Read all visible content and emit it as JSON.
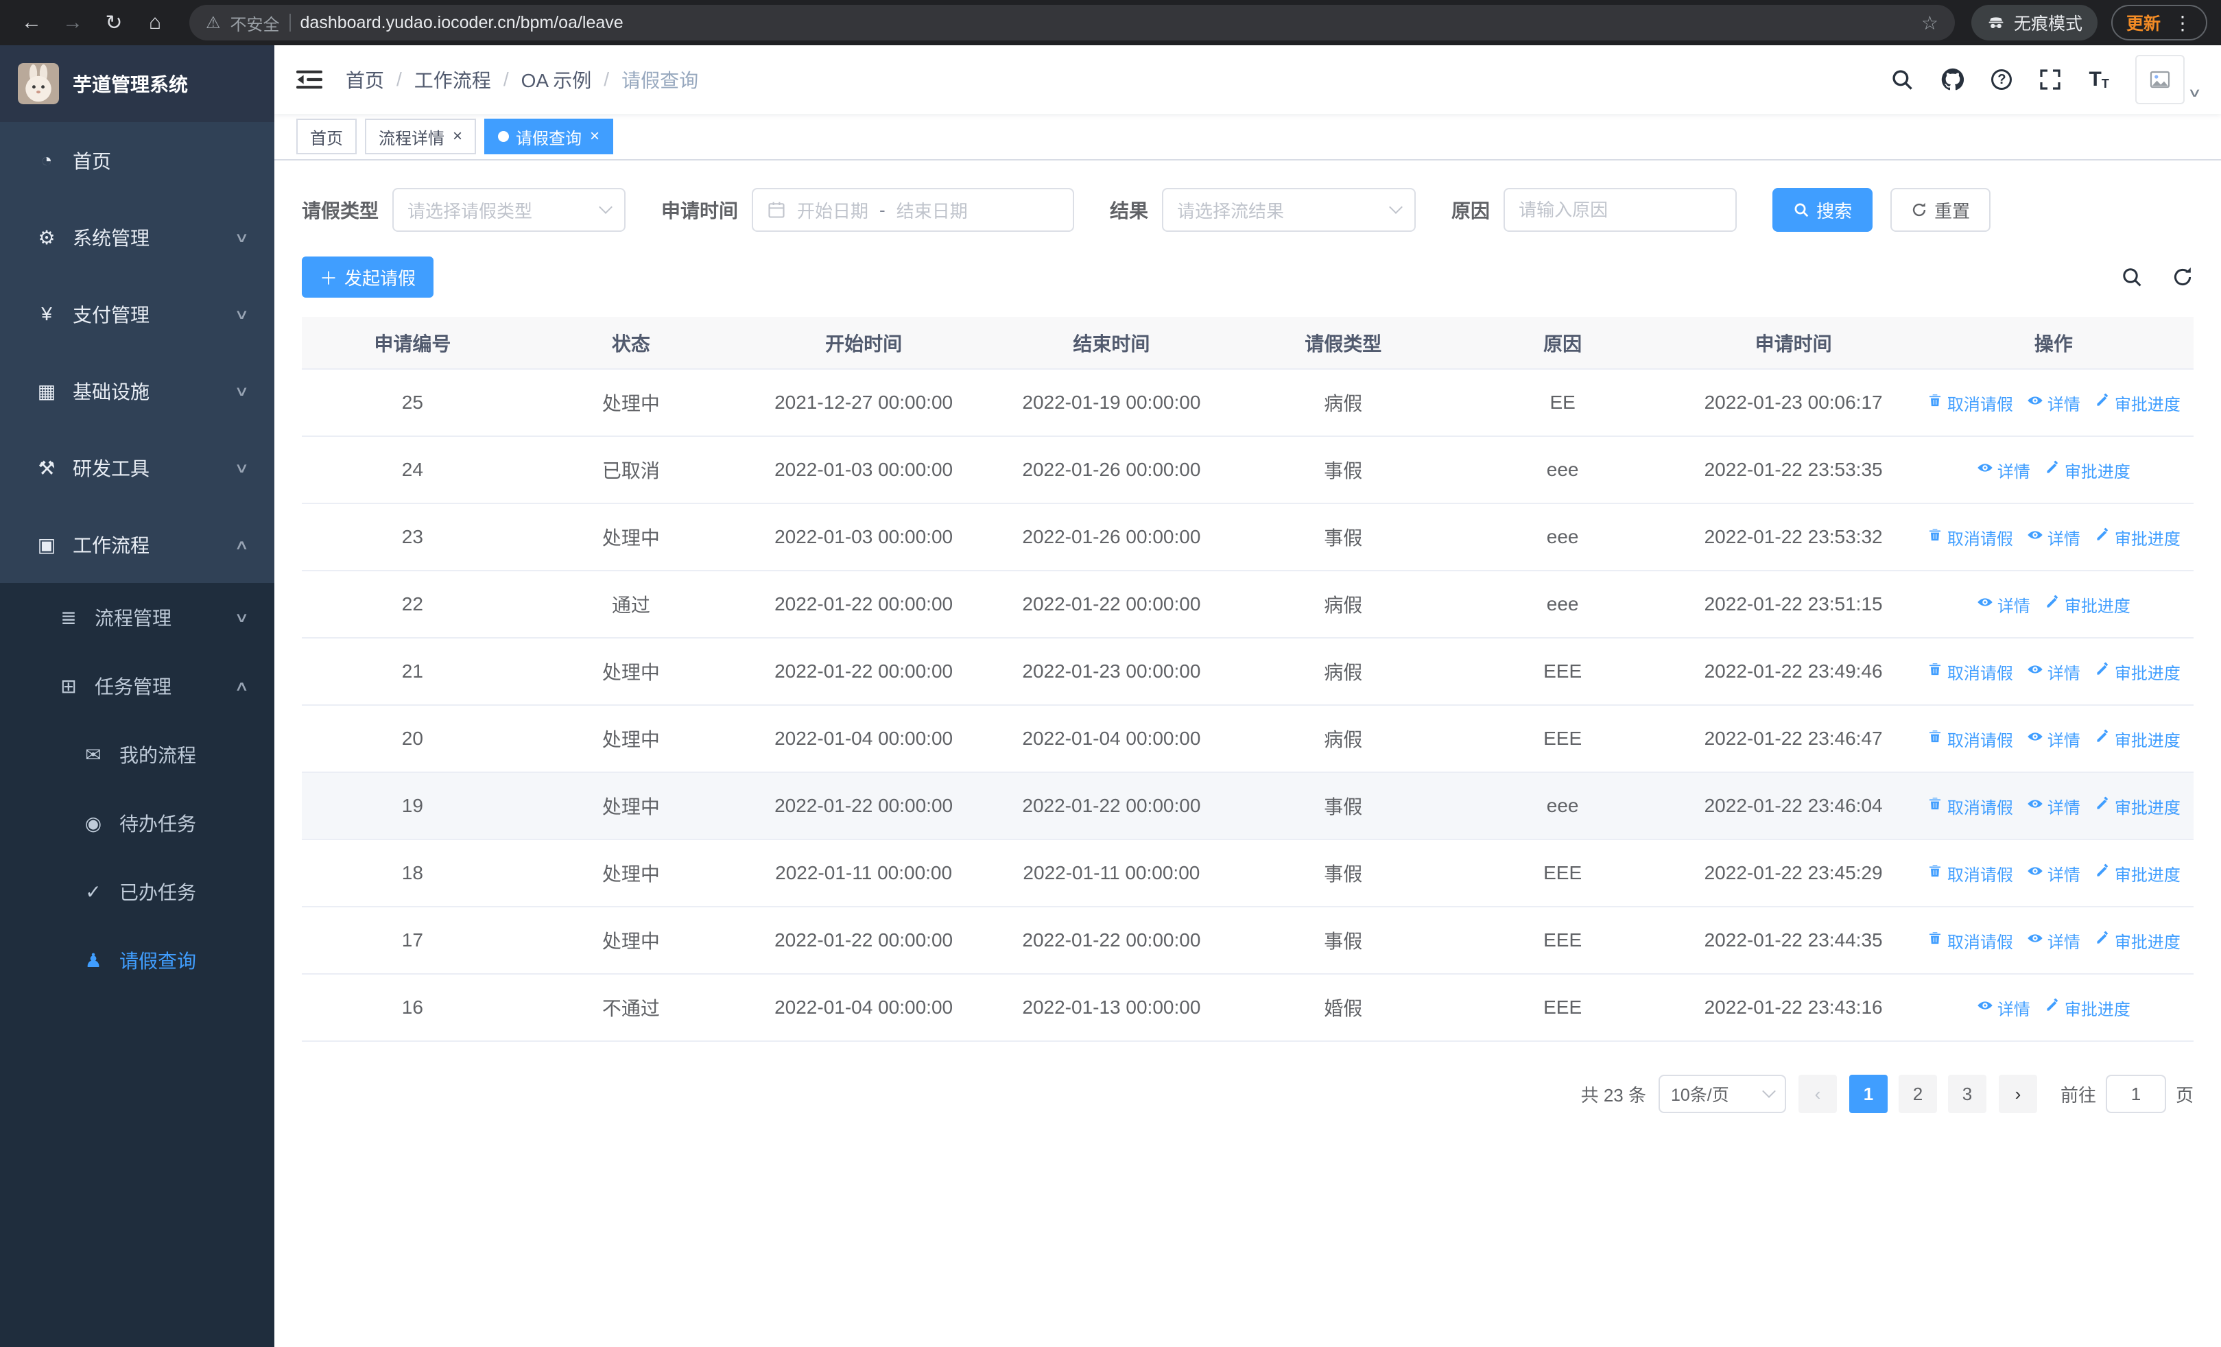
{
  "browser": {
    "security_warning": "不安全",
    "url": "dashboard.yudao.iocoder.cn/bpm/oa/leave",
    "incognito_label": "无痕模式",
    "update_label": "更新"
  },
  "sidebar": {
    "logo_title": "芋道管理系统",
    "items": [
      {
        "key": "home",
        "label": "首页",
        "icon": "dashboard-icon"
      },
      {
        "key": "system-management",
        "label": "系统管理",
        "icon": "gear-icon",
        "chevron": "down"
      },
      {
        "key": "payment-management",
        "label": "支付管理",
        "icon": "yen-icon",
        "chevron": "down"
      },
      {
        "key": "infrastructure",
        "label": "基础设施",
        "icon": "grid-icon",
        "chevron": "down"
      },
      {
        "key": "dev-tools",
        "label": "研发工具",
        "icon": "tools-icon",
        "chevron": "down"
      },
      {
        "key": "workflow",
        "label": "工作流程",
        "icon": "briefcase-icon",
        "chevron": "up",
        "children": [
          {
            "key": "process-management",
            "label": "流程管理",
            "icon": "list-icon",
            "chevron": "down"
          },
          {
            "key": "task-management",
            "label": "任务管理",
            "icon": "tasks-icon",
            "chevron": "up",
            "children": [
              {
                "key": "my-process",
                "label": "我的流程",
                "icon": "message-icon"
              },
              {
                "key": "todo-tasks",
                "label": "待办任务",
                "icon": "eye-icon"
              },
              {
                "key": "done-tasks",
                "label": "已办任务",
                "icon": "check-icon"
              },
              {
                "key": "leave-query",
                "label": "请假查询",
                "icon": "user-icon",
                "active": true
              }
            ]
          }
        ]
      }
    ]
  },
  "header": {
    "breadcrumb": [
      "首页",
      "工作流程",
      "OA 示例",
      "请假查询"
    ]
  },
  "tabs": [
    {
      "key": "home",
      "label": "首页",
      "closable": false,
      "active": false
    },
    {
      "key": "process-detail",
      "label": "流程详情",
      "closable": true,
      "active": false
    },
    {
      "key": "leave-query",
      "label": "请假查询",
      "closable": true,
      "active": true
    }
  ],
  "filters": {
    "leave_type_label": "请假类型",
    "leave_type_placeholder": "请选择请假类型",
    "apply_time_label": "申请时间",
    "date_start_placeholder": "开始日期",
    "date_separator": "-",
    "date_end_placeholder": "结束日期",
    "result_label": "结果",
    "result_placeholder": "请选择流结果",
    "reason_label": "原因",
    "reason_placeholder": "请输入原因",
    "search_button": "搜索",
    "reset_button": "重置"
  },
  "toolbar": {
    "create_button": "发起请假"
  },
  "table": {
    "columns": [
      "申请编号",
      "状态",
      "开始时间",
      "结束时间",
      "请假类型",
      "原因",
      "申请时间",
      "操作"
    ],
    "action_labels": {
      "cancel": "取消请假",
      "detail": "详情",
      "progress": "审批进度"
    },
    "rows": [
      {
        "id": "25",
        "status": "处理中",
        "start": "2021-12-27 00:00:00",
        "end": "2022-01-19 00:00:00",
        "type": "病假",
        "reason": "EE",
        "applied": "2022-01-23 00:06:17",
        "actions": [
          "cancel",
          "detail",
          "progress"
        ]
      },
      {
        "id": "24",
        "status": "已取消",
        "start": "2022-01-03 00:00:00",
        "end": "2022-01-26 00:00:00",
        "type": "事假",
        "reason": "eee",
        "applied": "2022-01-22 23:53:35",
        "actions": [
          "detail",
          "progress"
        ]
      },
      {
        "id": "23",
        "status": "处理中",
        "start": "2022-01-03 00:00:00",
        "end": "2022-01-26 00:00:00",
        "type": "事假",
        "reason": "eee",
        "applied": "2022-01-22 23:53:32",
        "actions": [
          "cancel",
          "detail",
          "progress"
        ]
      },
      {
        "id": "22",
        "status": "通过",
        "start": "2022-01-22 00:00:00",
        "end": "2022-01-22 00:00:00",
        "type": "病假",
        "reason": "eee",
        "applied": "2022-01-22 23:51:15",
        "actions": [
          "detail",
          "progress"
        ]
      },
      {
        "id": "21",
        "status": "处理中",
        "start": "2022-01-22 00:00:00",
        "end": "2022-01-23 00:00:00",
        "type": "病假",
        "reason": "EEE",
        "applied": "2022-01-22 23:49:46",
        "actions": [
          "cancel",
          "detail",
          "progress"
        ]
      },
      {
        "id": "20",
        "status": "处理中",
        "start": "2022-01-04 00:00:00",
        "end": "2022-01-04 00:00:00",
        "type": "病假",
        "reason": "EEE",
        "applied": "2022-01-22 23:46:47",
        "actions": [
          "cancel",
          "detail",
          "progress"
        ]
      },
      {
        "id": "19",
        "status": "处理中",
        "start": "2022-01-22 00:00:00",
        "end": "2022-01-22 00:00:00",
        "type": "事假",
        "reason": "eee",
        "applied": "2022-01-22 23:46:04",
        "actions": [
          "cancel",
          "detail",
          "progress"
        ],
        "highlighted": true
      },
      {
        "id": "18",
        "status": "处理中",
        "start": "2022-01-11 00:00:00",
        "end": "2022-01-11 00:00:00",
        "type": "事假",
        "reason": "EEE",
        "applied": "2022-01-22 23:45:29",
        "actions": [
          "cancel",
          "detail",
          "progress"
        ]
      },
      {
        "id": "17",
        "status": "处理中",
        "start": "2022-01-22 00:00:00",
        "end": "2022-01-22 00:00:00",
        "type": "事假",
        "reason": "EEE",
        "applied": "2022-01-22 23:44:35",
        "actions": [
          "cancel",
          "detail",
          "progress"
        ]
      },
      {
        "id": "16",
        "status": "不通过",
        "start": "2022-01-04 00:00:00",
        "end": "2022-01-13 00:00:00",
        "type": "婚假",
        "reason": "EEE",
        "applied": "2022-01-22 23:43:16",
        "actions": [
          "detail",
          "progress"
        ]
      }
    ]
  },
  "pagination": {
    "total_text": "共 23 条",
    "page_size": "10条/页",
    "pages": [
      "1",
      "2",
      "3"
    ],
    "active_page": "1",
    "goto_label": "前往",
    "goto_value": "1",
    "goto_suffix": "页"
  },
  "colors": {
    "primary": "#409eff",
    "sidebar_bg": "#304156",
    "submenu_bg": "#1f2d3d",
    "update_accent": "#f28b25"
  }
}
